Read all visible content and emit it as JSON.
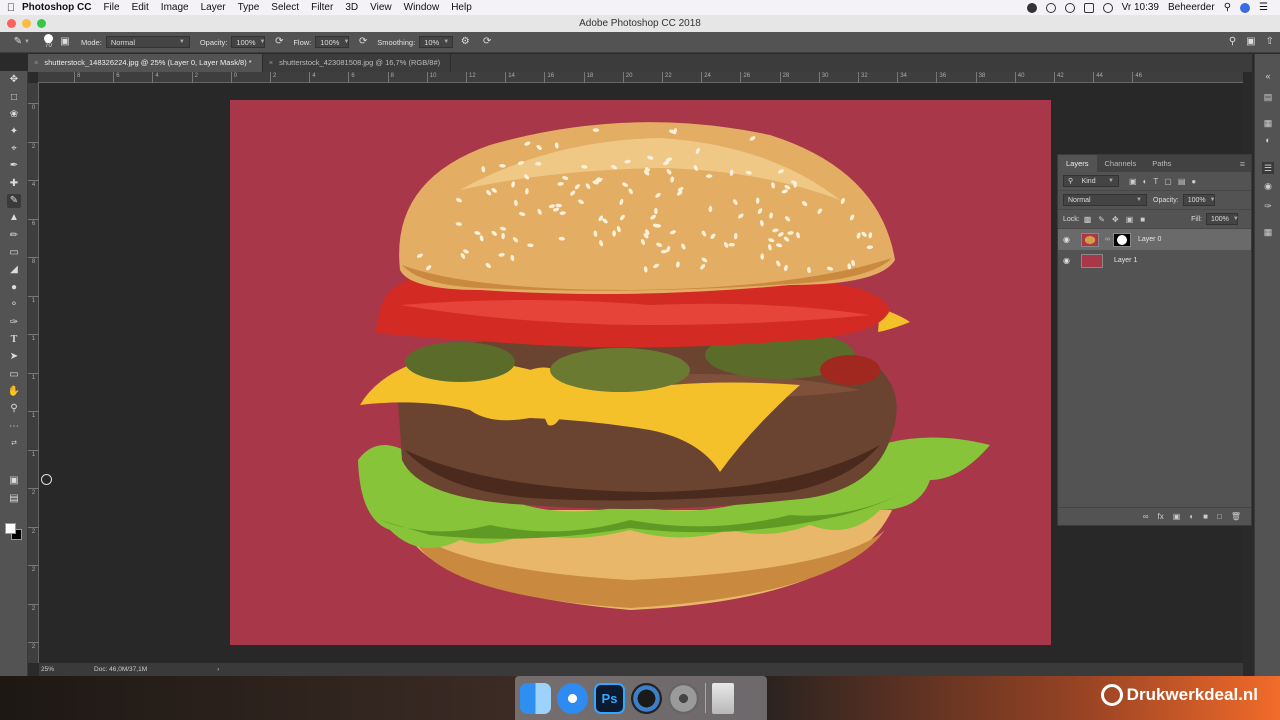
{
  "menubar": {
    "app_name": "Photoshop CC",
    "items": [
      "File",
      "Edit",
      "Image",
      "Layer",
      "Type",
      "Select",
      "Filter",
      "3D",
      "View",
      "Window",
      "Help"
    ],
    "clock": "Vr 10:39",
    "user": "Beheerder"
  },
  "window": {
    "title": "Adobe Photoshop CC 2018"
  },
  "options": {
    "brush_size": "70",
    "mode_label": "Mode:",
    "mode_value": "Normal",
    "opacity_label": "Opacity:",
    "opacity_value": "100%",
    "flow_label": "Flow:",
    "flow_value": "100%",
    "smoothing_label": "Smoothing:",
    "smoothing_value": "10%"
  },
  "tabs": [
    {
      "label": "shutterstock_148326224.jpg @ 25% (Layer 0, Layer Mask/8) *",
      "active": true
    },
    {
      "label": "shutterstock_423081508.jpg @ 16,7% (RGB/8#)",
      "active": false
    }
  ],
  "ruler": {
    "top": [
      "8",
      "6",
      "4",
      "2",
      "0",
      "2",
      "4",
      "6",
      "8",
      "10",
      "12",
      "14",
      "16",
      "18",
      "20",
      "22",
      "24",
      "26",
      "28",
      "30",
      "32",
      "34",
      "36",
      "38",
      "40",
      "42",
      "44",
      "46"
    ],
    "left": [
      "0",
      "2",
      "4",
      "6",
      "8",
      "1",
      "1",
      "1",
      "1",
      "1",
      "2",
      "2",
      "2",
      "2",
      "2"
    ]
  },
  "layers_panel": {
    "tabs": [
      "Layers",
      "Channels",
      "Paths"
    ],
    "filter_label": "Kind",
    "blend_mode": "Normal",
    "opacity_label": "Opacity:",
    "opacity_value": "100%",
    "lock_label": "Lock:",
    "fill_label": "Fill:",
    "fill_value": "100%",
    "layers": [
      {
        "name": "Layer 0",
        "selected": true
      },
      {
        "name": "Layer 1",
        "selected": false
      }
    ]
  },
  "status": {
    "zoom": "25%",
    "doc": "Doc: 46,0M/37,1M"
  },
  "dock": {
    "ps_label": "Ps"
  },
  "watermark": {
    "text": "Drukwerkdeal.nl"
  },
  "colors": {
    "canvas_bg": "#a83749",
    "ps_blue": "#31a8ff"
  }
}
